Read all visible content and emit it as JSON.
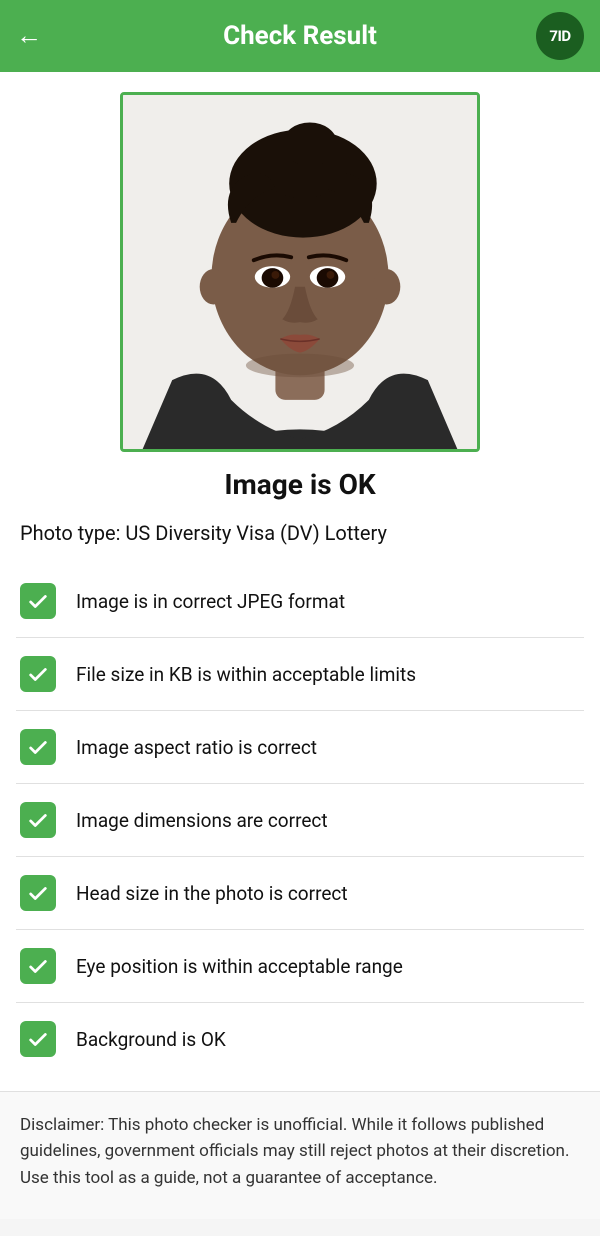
{
  "header": {
    "title": "Check Result",
    "back_label": "←",
    "logo_text": "7ID",
    "logo_bg": "#1b5e20",
    "bg_color": "#4caf50"
  },
  "status": {
    "label": "Image is OK"
  },
  "photo_type": {
    "label": "Photo type: US Diversity Visa (DV) Lottery"
  },
  "checks": [
    {
      "id": 1,
      "text": "Image is in correct JPEG format",
      "passed": true
    },
    {
      "id": 2,
      "text": "File size in KB is within acceptable limits",
      "passed": true
    },
    {
      "id": 3,
      "text": "Image aspect ratio is correct",
      "passed": true
    },
    {
      "id": 4,
      "text": "Image dimensions are correct",
      "passed": true
    },
    {
      "id": 5,
      "text": "Head size in the photo is correct",
      "passed": true
    },
    {
      "id": 6,
      "text": "Eye position is within acceptable range",
      "passed": true
    },
    {
      "id": 7,
      "text": "Background is OK",
      "passed": true
    }
  ],
  "disclaimer": {
    "text": "Disclaimer: This photo checker is unofficial. While it follows published guidelines, government officials may still reject photos at their discretion. Use this tool as a guide, not a guarantee of acceptance."
  }
}
